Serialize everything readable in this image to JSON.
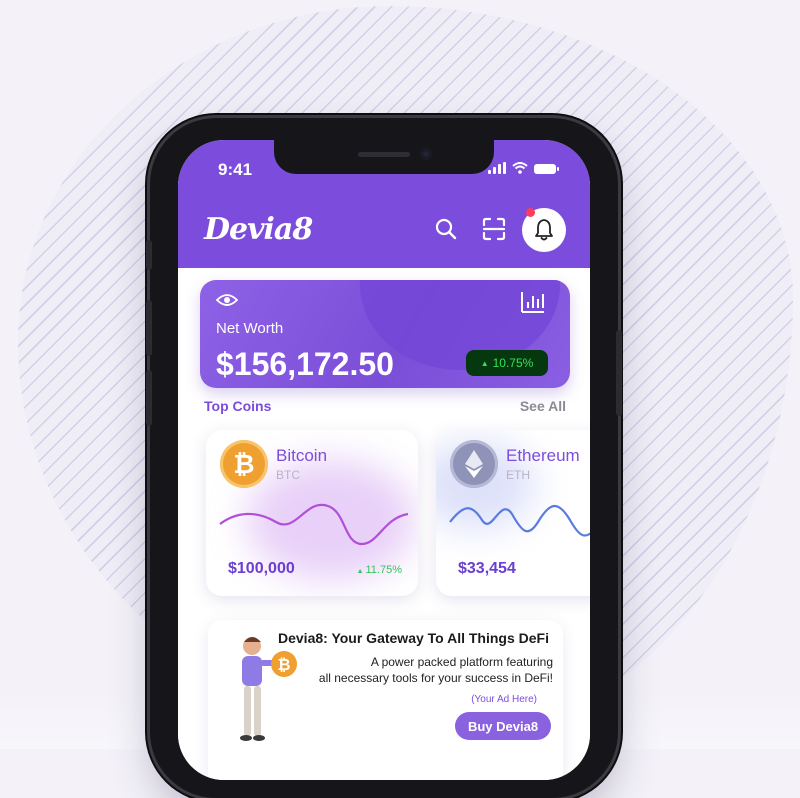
{
  "status_bar": {
    "time": "9:41"
  },
  "header": {
    "logo_text": "Devia8",
    "icons": [
      "search-icon",
      "scan-icon",
      "bell-icon"
    ]
  },
  "net_worth": {
    "label": "Net Worth",
    "amount": "$156,172.50",
    "change": "10.75%"
  },
  "top_coins": {
    "title": "Top Coins",
    "see_all": "See All",
    "coins": [
      {
        "name": "Bitcoin",
        "symbol": "BTC",
        "price": "$100,000",
        "change": "11.75%"
      },
      {
        "name": "Ethereum",
        "symbol": "ETH",
        "price": "$33,454"
      }
    ]
  },
  "ad": {
    "title": "Devia8: Your Gateway To All Things DeFi",
    "desc_line1": "A power packed platform featuring",
    "desc_line2": "all necessary tools for your success in DeFi!",
    "note": "(Your Ad Here)",
    "button": "Buy Devia8"
  },
  "colors": {
    "brand_purple": "#7c4ddc",
    "positive_green": "#35e05a",
    "btc_orange": "#f0a030",
    "eth_gray": "#8f93b8"
  }
}
